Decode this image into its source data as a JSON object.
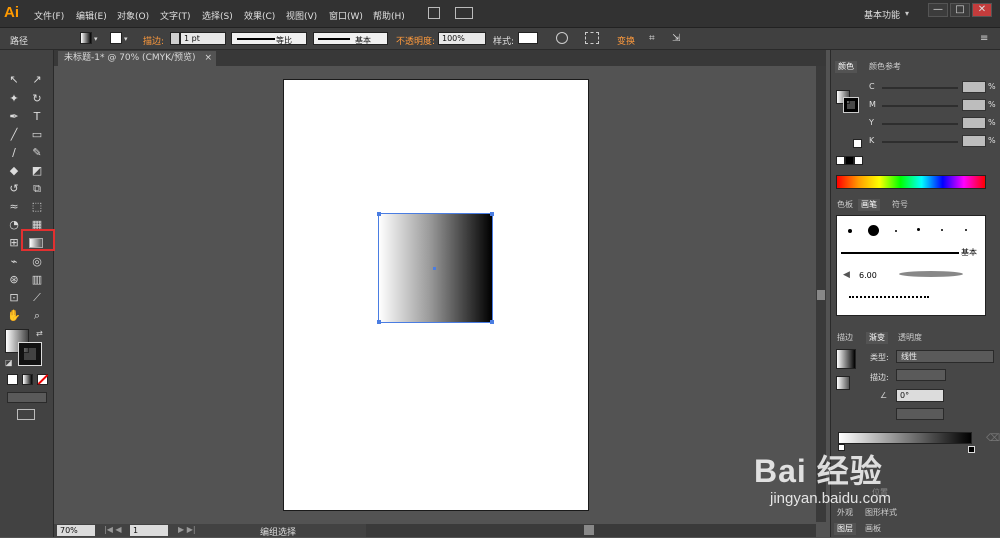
{
  "app": {
    "logo": "Ai",
    "menu": [
      "文件(F)",
      "编辑(E)",
      "对象(O)",
      "文字(T)",
      "选择(S)",
      "效果(C)",
      "视图(V)",
      "窗口(W)",
      "帮助(H)"
    ],
    "workspace": "基本功能",
    "window_controls": [
      "—",
      "□",
      "✕"
    ]
  },
  "control_bar": {
    "selection_label": "路径",
    "stroke_label": "描边:",
    "stroke_weight": "1 pt",
    "profile_label": "等比",
    "brush_label": "基本",
    "opacity_label": "不透明度:",
    "opacity_value": "100%",
    "style_label": "样式:",
    "transform_label": "变换"
  },
  "document": {
    "tab_title": "未标题-1* @ 70% (CMYK/预览)",
    "tab_close": "×"
  },
  "status": {
    "zoom": "70%",
    "page": "1",
    "tool_status": "编组选择"
  },
  "color_panel": {
    "tabs": [
      "颜色",
      "颜色参考"
    ],
    "channels": [
      "C",
      "M",
      "Y",
      "K"
    ],
    "unit": "%"
  },
  "brush_panel": {
    "tabs": [
      "色板",
      "画笔",
      "符号"
    ],
    "basic_label": "基本",
    "size_value": "6.00"
  },
  "gradient_panel": {
    "tabs": [
      "描边",
      "渐变",
      "透明度"
    ],
    "type_label": "类型:",
    "type_value": "线性",
    "stroke_label": "描边:",
    "angle_value": "0°",
    "location_label": "位置"
  },
  "appearance_tabs": [
    "外观",
    "图形样式"
  ],
  "layers_tabs": [
    "图层",
    "画板"
  ],
  "watermark": {
    "text": "Bai 经验",
    "url": "jingyan.baidu.com"
  },
  "colors": {
    "accent": "#ff9a00",
    "selection": "#4a7de2",
    "highlight": "#e23030"
  }
}
